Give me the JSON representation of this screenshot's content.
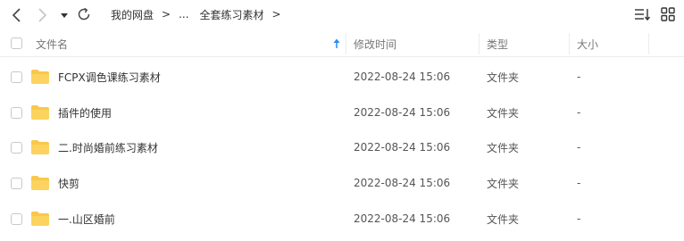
{
  "toolbar": {
    "back_icon": "chevron-left-icon",
    "forward_icon": "chevron-right-icon",
    "history_icon": "caret-down-icon",
    "refresh_icon": "refresh-icon",
    "sort_icon": "sort-lines-icon",
    "view_icon": "grid-view-icon"
  },
  "breadcrumb": {
    "items": [
      "我的网盘",
      "...",
      "全套练习素材"
    ],
    "separator": ">"
  },
  "table": {
    "columns": {
      "name": "文件名",
      "time": "修改时间",
      "type": "类型",
      "size": "大小"
    },
    "sort_icon": "arrow-up-icon",
    "rows": [
      {
        "name": "FCPX调色课练习素材",
        "time": "2022-08-24 15:06",
        "type": "文件夹",
        "size": "-"
      },
      {
        "name": "插件的使用",
        "time": "2022-08-24 15:06",
        "type": "文件夹",
        "size": "-"
      },
      {
        "name": "二.时尚婚前练习素材",
        "time": "2022-08-24 15:06",
        "type": "文件夹",
        "size": "-"
      },
      {
        "name": "快剪",
        "time": "2022-08-24 15:06",
        "type": "文件夹",
        "size": "-"
      },
      {
        "name": "一.山区婚前",
        "time": "2022-08-24 15:06",
        "type": "文件夹",
        "size": "-"
      }
    ]
  },
  "colors": {
    "folder": "#F9C84A",
    "accent": "#2B8CF6",
    "text": "#333333",
    "muted": "#777777"
  }
}
